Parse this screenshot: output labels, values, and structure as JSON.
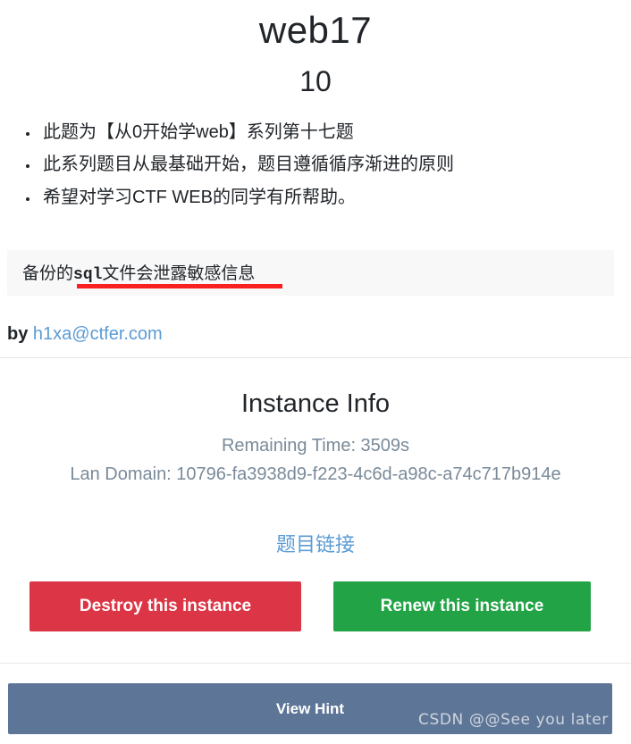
{
  "challenge": {
    "title": "web17",
    "score": "10",
    "description_items": [
      "此题为【从0开始学web】系列第十七题",
      "此系列题目从最基础开始，题目遵循循序渐进的原则",
      "希望对学习CTF WEB的同学有所帮助。"
    ],
    "hint_panel": {
      "prefix": "备份的",
      "emphasis": "sql",
      "suffix": "文件会泄露敏感信息",
      "underline_color": "#fb2020",
      "background": "#f8f8f8"
    },
    "author": {
      "by_label": "by",
      "email": "h1xa@ctfer.com",
      "link_color": "#5b9bd5"
    }
  },
  "instance": {
    "heading": "Instance Info",
    "remaining_time": "Remaining Time: 3509s",
    "lan_domain": "Lan Domain: 10796-fa3938d9-f223-4c6d-a98c-a74c717b914e",
    "challenge_link": "题目链接"
  },
  "actions": {
    "destroy_label": "Destroy this instance",
    "destroy_color": "#dc3545",
    "renew_label": "Renew this instance",
    "renew_color": "#22a345",
    "view_hint_label": "View Hint",
    "view_hint_color": "#5d7596"
  },
  "watermark": {
    "text": "CSDN @@See  you   later"
  }
}
